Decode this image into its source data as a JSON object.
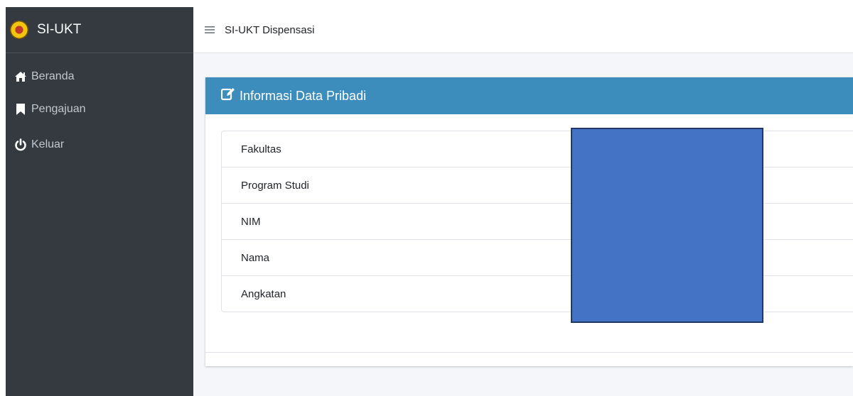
{
  "sidebar": {
    "brand": "SI-UKT",
    "items": [
      {
        "label": "Beranda",
        "icon": "home-icon"
      },
      {
        "label": "Pengajuan",
        "icon": "bookmark-icon"
      },
      {
        "label": "Keluar",
        "icon": "power-icon"
      }
    ]
  },
  "header": {
    "title": "SI-UKT Dispensasi",
    "menu_icon": "hamburger-icon"
  },
  "card": {
    "title": "Informasi Data Pribadi",
    "icon": "edit-icon",
    "fields": [
      {
        "label": "Fakultas"
      },
      {
        "label": "Program Studi"
      },
      {
        "label": "NIM"
      },
      {
        "label": "Nama"
      },
      {
        "label": "Angkatan"
      }
    ]
  },
  "colors": {
    "sidebar_bg": "#343a40",
    "card_header_bg": "#3c8dbc",
    "redaction_fill": "#4472c4"
  }
}
